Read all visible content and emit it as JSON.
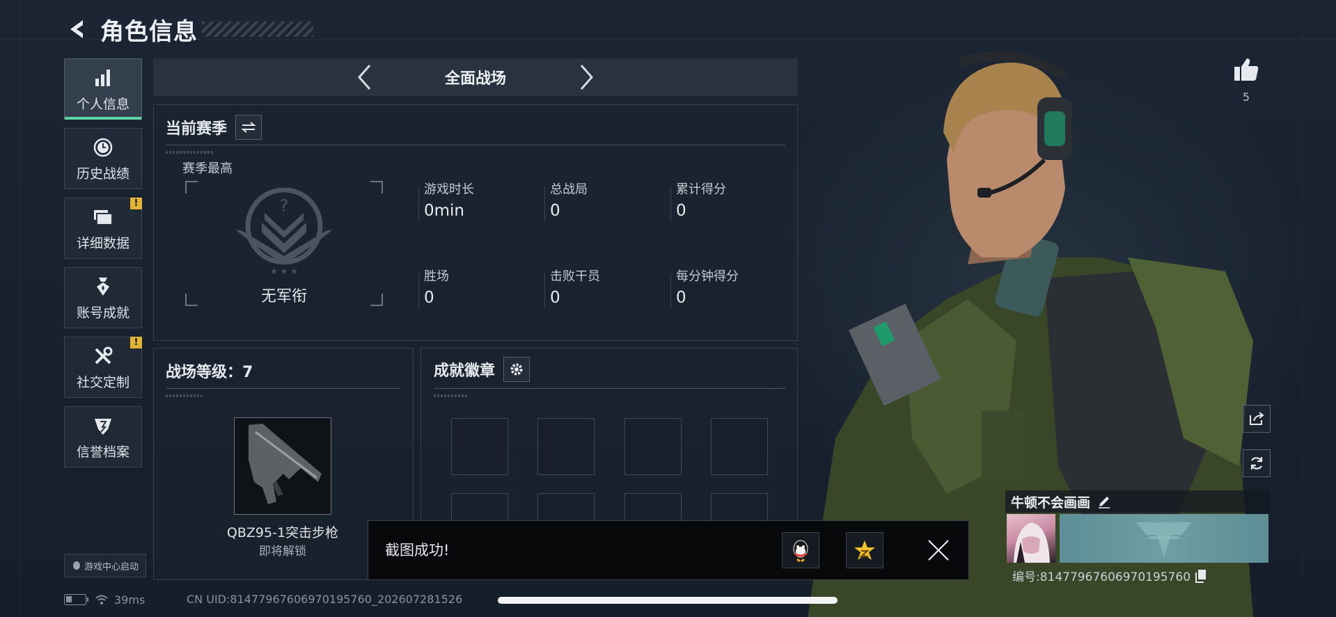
{
  "header": {
    "title": "角色信息"
  },
  "sidebar": {
    "items": [
      {
        "label": "个人信息",
        "icon": "bar-chart-icon",
        "active": true,
        "alert": false
      },
      {
        "label": "历史战绩",
        "icon": "clock-icon",
        "active": false,
        "alert": false
      },
      {
        "label": "详细数据",
        "icon": "folder-icon",
        "active": false,
        "alert": true
      },
      {
        "label": "账号成就",
        "icon": "medal-icon",
        "active": false,
        "alert": false
      },
      {
        "label": "社交定制",
        "icon": "tools-icon",
        "active": false,
        "alert": true
      },
      {
        "label": "信誉档案",
        "icon": "shield-icon",
        "active": false,
        "alert": false
      }
    ],
    "alert_mark": "!",
    "launch_label": "游戏中心启动"
  },
  "mode": {
    "title": "全面战场"
  },
  "season": {
    "title": "当前赛季",
    "season_high_label": "赛季最高",
    "rank_name": "无军衔",
    "stats": [
      {
        "label": "游戏时长",
        "value": "0min"
      },
      {
        "label": "总战局",
        "value": "0"
      },
      {
        "label": "累计得分",
        "value": "0"
      },
      {
        "label": "胜场",
        "value": "0"
      },
      {
        "label": "击败干员",
        "value": "0"
      },
      {
        "label": "每分钟得分",
        "value": "0"
      }
    ]
  },
  "level_panel": {
    "title": "战场等级：7",
    "weapon_name": "QBZ95-1突击步枪",
    "weapon_status": "即将解锁"
  },
  "badges_panel": {
    "title": "成就徽章"
  },
  "toast": {
    "message": "截图成功!"
  },
  "status_bar": {
    "ping": "39ms",
    "uid": "CN UID:814779676069701957​60_202607281526"
  },
  "profile": {
    "likes": "5",
    "name": "牛顿不会画画",
    "id_label": "编号:814779676069701957​60"
  },
  "colors": {
    "accent": "#5ed3a4",
    "alert": "#e0b437",
    "background": "#172130"
  }
}
